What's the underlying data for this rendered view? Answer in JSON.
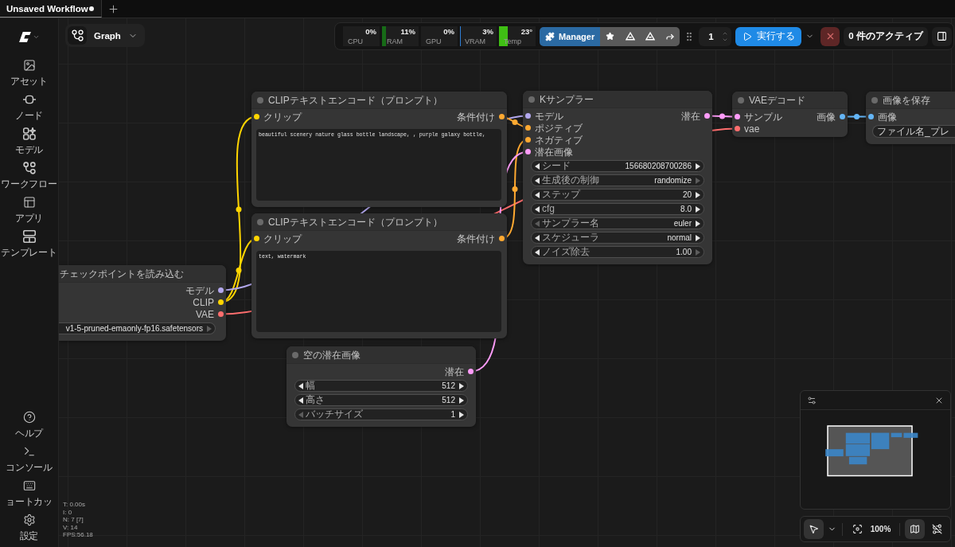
{
  "tabs": [
    {
      "label": "Unsaved Workflow",
      "selected": true,
      "unsaved": true
    }
  ],
  "graph_menu": {
    "label": "Graph"
  },
  "system_monitor": [
    {
      "label": "CPU",
      "reading": "0%"
    },
    {
      "label": "RAM",
      "reading": "11%",
      "level": 0.11,
      "color": "#176b17"
    },
    {
      "label": "GPU",
      "reading": "0%"
    },
    {
      "label": "VRAM",
      "reading": "3%",
      "level": 0.03,
      "color": "#2f7fd6"
    },
    {
      "label": "Temp",
      "reading": "23°",
      "level": 0.23,
      "color": "#3fbf14"
    }
  ],
  "manager_button": {
    "label": "Manager"
  },
  "queue": {
    "batch_count": "1",
    "run_label": "実行する",
    "active_jobs": "0 件のアクティブ"
  },
  "sidebar": {
    "top_items": [
      {
        "label": "アセット",
        "selected": false
      },
      {
        "label": "ノード",
        "selected": false
      },
      {
        "label": "モデル",
        "selected": false
      },
      {
        "label": "ワークフロー",
        "selected": false
      },
      {
        "label": "アプリ",
        "selected": false
      },
      {
        "label": "テンプレート",
        "selected": false
      }
    ],
    "bottom_items": [
      {
        "label": "ヘルプ",
        "selected": false
      },
      {
        "label": "コンソール",
        "selected": false
      },
      {
        "label": "ョートカッ",
        "selected": false
      },
      {
        "label": "設定",
        "selected": false
      }
    ]
  },
  "nodes": [
    {
      "title": "CLIPテキストエンコード（プロンプト）",
      "inputs": [
        {
          "label": "クリップ",
          "color": "#ffd500"
        }
      ],
      "outputs": [
        {
          "label": "条件付け",
          "color": "#ffa931"
        }
      ],
      "widgets": [
        {
          "kind": "textarea",
          "value": "beautiful scenery nature glass bottle landscape, , purple galaxy bottle,"
        }
      ]
    },
    {
      "title": "Kサンプラー",
      "inputs": [
        {
          "label": "モデル",
          "color": "#b3a8ee"
        },
        {
          "label": "ポジティブ",
          "color": "#ffa931"
        },
        {
          "label": "ネガティブ",
          "color": "#ffa931"
        },
        {
          "label": "潜在画像",
          "color": "#ff9cf9"
        }
      ],
      "outputs": [
        {
          "label": "潜在",
          "color": "#ff9cf9"
        }
      ],
      "widgets": [
        {
          "kind": "stepper",
          "label": "シード",
          "value": "156680208700286",
          "prev_disabled": false,
          "next_disabled": false
        },
        {
          "kind": "stepper",
          "label": "生成後の制御",
          "value": "randomize",
          "prev_disabled": false,
          "next_disabled": true
        },
        {
          "kind": "stepper",
          "label": "ステップ",
          "value": "20",
          "prev_disabled": false,
          "next_disabled": false
        },
        {
          "kind": "stepper",
          "label": "cfg",
          "value": "8.0",
          "prev_disabled": false,
          "next_disabled": false
        },
        {
          "kind": "stepper",
          "label": "サンプラー名",
          "value": "euler",
          "prev_disabled": true,
          "next_disabled": false
        },
        {
          "kind": "stepper",
          "label": "スケジューラ",
          "value": "normal",
          "prev_disabled": false,
          "next_disabled": false
        },
        {
          "kind": "stepper",
          "label": "ノイズ除去",
          "value": "1.00",
          "prev_disabled": false,
          "next_disabled": true
        }
      ]
    },
    {
      "title": "VAEデコード",
      "inputs": [
        {
          "label": "サンプル",
          "color": "#ff9cf9"
        },
        {
          "label": "vae",
          "color": "#ff6e6e"
        }
      ],
      "outputs": [
        {
          "label": "画像",
          "color": "#64b5f6"
        }
      ]
    },
    {
      "title": "画像を保存",
      "inputs": [
        {
          "label": "画像",
          "color": "#64b5f6"
        }
      ],
      "widgets": [
        {
          "kind": "text",
          "label": "ファイル名_プレ"
        }
      ]
    },
    {
      "title": "CLIPテキストエンコード（プロンプト）",
      "inputs": [
        {
          "label": "クリップ",
          "color": "#ffd500"
        }
      ],
      "outputs": [
        {
          "label": "条件付け",
          "color": "#ffa931"
        }
      ],
      "widgets": [
        {
          "kind": "textarea",
          "value": "text, watermark"
        }
      ]
    },
    {
      "title": "チェックポイントを読み込む",
      "outputs": [
        {
          "label": "モデル",
          "color": "#b3a8ee"
        },
        {
          "label": "CLIP",
          "color": "#ffd500"
        },
        {
          "label": "VAE",
          "color": "#ff6e6e"
        }
      ],
      "widgets": [
        {
          "kind": "stepper",
          "value": "v1-5-pruned-emaonly-fp16.safetensors",
          "next_disabled": true
        }
      ]
    },
    {
      "title": "空の潜在画像",
      "outputs": [
        {
          "label": "潜在",
          "color": "#ff9cf9"
        }
      ],
      "widgets": [
        {
          "kind": "stepper",
          "label": "幅",
          "value": "512",
          "prev_disabled": false,
          "next_disabled": false
        },
        {
          "kind": "stepper",
          "label": "高さ",
          "value": "512",
          "prev_disabled": false,
          "next_disabled": false
        },
        {
          "kind": "stepper",
          "label": "バッチサイズ",
          "value": "1",
          "prev_disabled": true,
          "next_disabled": false
        }
      ]
    }
  ],
  "canvas_stats": [
    "T: 0.00s",
    "I: 0",
    "N: 7 [7]",
    "V: 14",
    "FPS:56.18"
  ],
  "canvas_controls": {
    "pointer_tool": {
      "selected": true
    },
    "zoom": "100%",
    "minimap": {
      "on": true
    }
  }
}
